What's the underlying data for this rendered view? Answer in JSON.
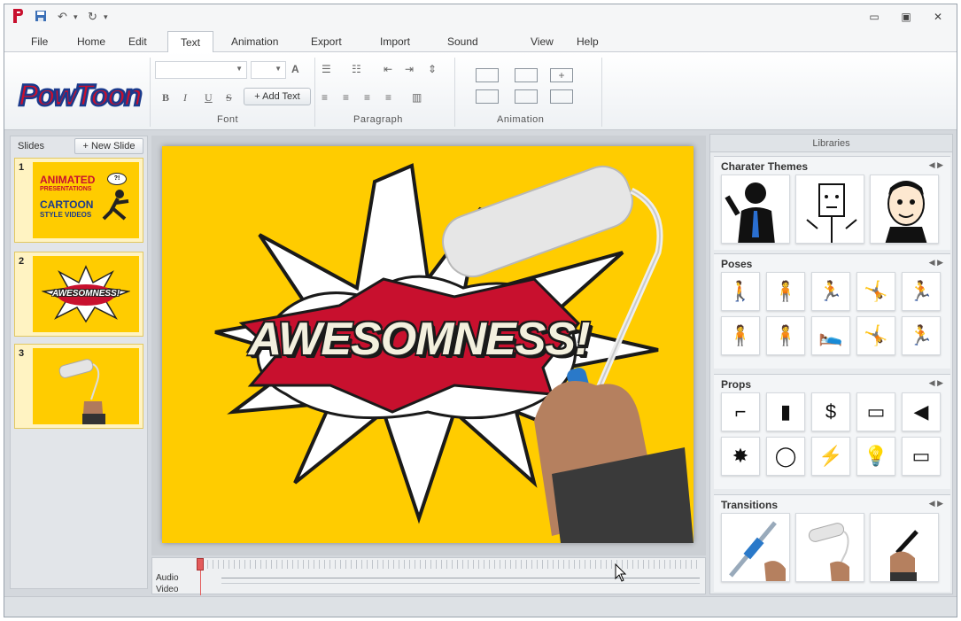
{
  "titlebar": {
    "quick_access": [
      "save-icon",
      "undo-icon",
      "redo-icon",
      "customize-icon"
    ],
    "undo_glyph": "↶",
    "redo_glyph": "↻",
    "minimize": "▭",
    "maximize": "▣",
    "close": "✕"
  },
  "menu": {
    "tabs": [
      "File",
      "Home",
      "Edit",
      "Text",
      "Animation",
      "Export",
      "Import",
      "Sound",
      "View",
      "Help"
    ],
    "active": "Text"
  },
  "ribbon": {
    "logo": "PowToon",
    "groups": {
      "font": "Font",
      "paragraph": "Paragraph",
      "animation": "Animation"
    },
    "add_text": "+ Add Text",
    "format_buttons": {
      "bold": "B",
      "italic": "I",
      "underline": "U",
      "strike": "S",
      "grow": "A"
    }
  },
  "slides": {
    "header": "Slides",
    "new_slide": "+ New Slide",
    "items": [
      {
        "num": "1",
        "lines": [
          "ANIMATED",
          "PRESENTATIONS",
          "CARTOON",
          "STYLE VIDEOS"
        ],
        "bubble": "?!"
      },
      {
        "num": "2",
        "title": "AWESOMNESS!"
      },
      {
        "num": "3"
      }
    ]
  },
  "canvas": {
    "headline": "AWESOMNESS!"
  },
  "timeline": {
    "audio": "Audio",
    "video": "Video"
  },
  "libraries": {
    "title": "Libraries",
    "sections": {
      "characters": "Charater Themes",
      "poses": "Poses",
      "props": "Props",
      "transitions": "Transitions"
    },
    "props_glyphs": [
      "⌐",
      "▮",
      "$",
      "▭",
      "◀",
      "✸",
      "◯",
      "⚡",
      "💡",
      "▭"
    ],
    "poses_glyphs": [
      "🚶",
      "🧍",
      "🏃",
      "🤸",
      "🏃",
      "🧍",
      "🧍",
      "🛌",
      "🤸",
      "🏃"
    ]
  }
}
